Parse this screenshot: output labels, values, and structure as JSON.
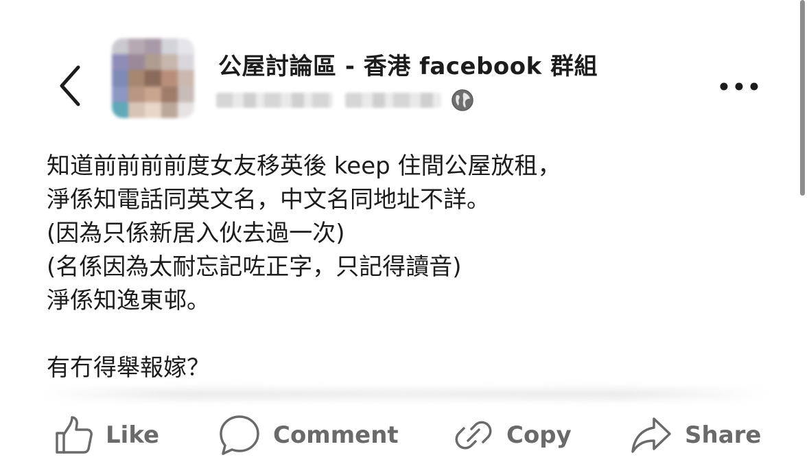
{
  "header": {
    "group_name": "公屋討論區 - 香港 facebook 群組",
    "back_icon": "chevron-left-icon",
    "privacy_icon": "globe-icon",
    "more_icon": "more-horizontal-icon"
  },
  "post": {
    "lines": [
      "知道前前前前度女友移英後 keep 住間公屋放租，",
      "淨係知電話同英文名，中文名同地址不詳。",
      "(因為只係新居入伙去過一次)",
      "(名係因為太耐忘記咗正字，只記得讀音)",
      "淨係知逸東邨。",
      "",
      "有冇得舉報嫁？"
    ]
  },
  "actions": {
    "like_label": "Like",
    "comment_label": "Comment",
    "copy_label": "Copy",
    "share_label": "Share"
  },
  "colors": {
    "text": "#1c1c1c",
    "action_text": "#6a6a6a",
    "background": "#ffffff"
  }
}
